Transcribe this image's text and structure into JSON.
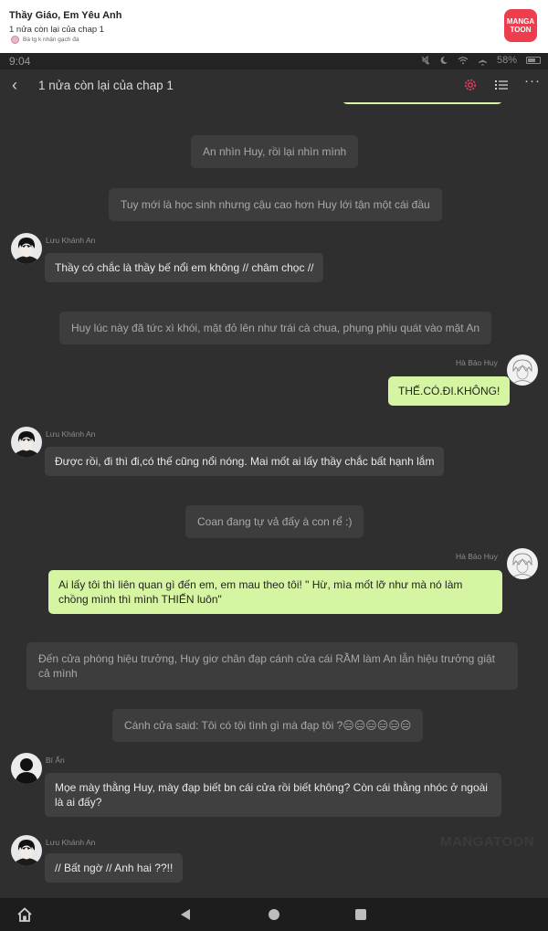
{
  "header": {
    "story_title": "Thầy Giáo, Em Yêu Anh",
    "chapter_subtitle": "1 nửa còn lại của chap 1",
    "author_line": "Bà tg k nhận gạch đá",
    "logo_line1": "MANGA",
    "logo_line2": "TOON"
  },
  "status_bar": {
    "time": "9:04",
    "battery": "58%"
  },
  "reader_bar": {
    "title": "1 nửa còn lại của chap 1",
    "icons": [
      "back-icon",
      "settings-icon",
      "list-icon",
      "more-icon"
    ]
  },
  "chat": {
    "messages": [
      {
        "type": "narration",
        "text": "An nhìn Huy, rồi lại nhìn mình"
      },
      {
        "type": "narration",
        "text": "Tuy mới là học sinh nhưng cậu cao hơn Huy lới tận một cái đầu"
      },
      {
        "type": "left",
        "speaker": "Lưu Khánh An",
        "text": "Thầy có chắc là thầy bế nổi em không // châm chọc //"
      },
      {
        "type": "narration",
        "text": "Huy lúc này đã tức xì khói, mặt đỏ lên như trái cà chua, phụng phịu quát vào mặt An"
      },
      {
        "type": "right",
        "speaker": "Hà Bảo Huy",
        "text": "THẾ.CÓ.ĐI.KHÔNG!"
      },
      {
        "type": "left",
        "speaker": "Lưu Khánh An",
        "text": "Được rồi, đi thì đi,có thế cũng nổi nóng. Mai mốt ai lấy thầy chắc bất hạnh lắm"
      },
      {
        "type": "narration",
        "text": "Coan đang tự vả đấy à con rể :)"
      },
      {
        "type": "right",
        "speaker": "Hà Bảo Huy",
        "text": "Ai lấy tôi thì liên quan gì đến em, em mau theo tôi! \" Hừ, mìa mốt lỡ như mà nó làm chồng mình thì mình THIẾN luôn\""
      },
      {
        "type": "narration",
        "text": "Đến cửa phòng hiệu trưởng, Huy giơ chân đạp cánh cửa cái RẦM làm An lẫn hiệu trưởng giật cả mình"
      },
      {
        "type": "narration",
        "text": "Cánh cửa said: Tôi có tội tình gì mà đạp tôi ?😑😑😑😑😑😑"
      },
      {
        "type": "left",
        "speaker": "Bí Ẩn",
        "text": "Mọe mày thằng Huy, mày đạp biết bn cái cửa rồi biết không? Còn cái thằng nhóc ở ngoài là ai đấy?"
      },
      {
        "type": "left",
        "speaker": "Lưu Khánh An",
        "text": "// Bất ngờ // Anh hai ??!!"
      }
    ],
    "watermark": "MANGATOON"
  },
  "colors": {
    "background": "#2f2f2f",
    "right_bubble": "#d6f5a3",
    "left_bubble": "#404040",
    "narration_bubble": "#3d3d3d",
    "accent": "#ee3d4c"
  }
}
